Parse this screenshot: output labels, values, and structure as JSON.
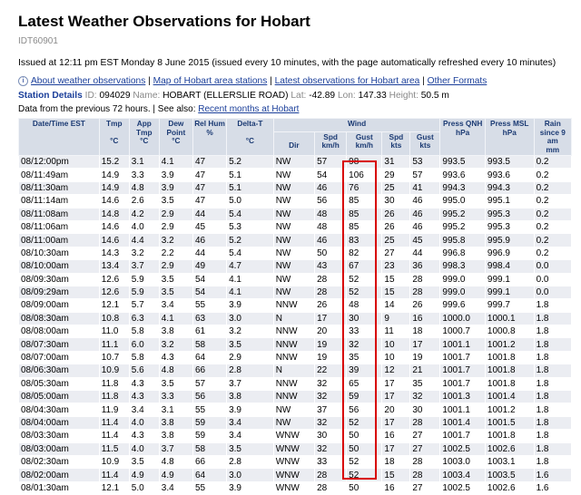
{
  "page": {
    "title": "Latest Weather Observations for Hobart",
    "product_id": "IDT60901",
    "issued": "Issued at 12:11 pm EST Monday 8 June 2015 (issued every 10 minutes, with the page automatically refreshed every 10 minutes)"
  },
  "links": {
    "about": "About weather observations",
    "map": "Map of Hobart area stations",
    "latest": "Latest observations for Hobart area",
    "formats": "Other Formats",
    "sep": " | "
  },
  "station": {
    "label": "Station Details",
    "id_label": "ID:",
    "id": "094029",
    "name_label": "Name:",
    "name": "HOBART (ELLERSLIE ROAD)",
    "lat_label": "Lat:",
    "lat": "-42.89",
    "lon_label": "Lon:",
    "lon": "147.33",
    "height_label": "Height:",
    "height": "50.5 m"
  },
  "prev": {
    "text": "Data from the previous 72 hours. | See also: ",
    "link": "Recent months at Hobart"
  },
  "table": {
    "headers": {
      "datetime": "Date/Time EST",
      "tmp": "Tmp",
      "tmp_unit": "°C",
      "app": "App Tmp",
      "app_unit": "°C",
      "dew": "Dew Point",
      "dew_unit": "°C",
      "rel": "Rel Hum",
      "rel_unit": "%",
      "delta": "Delta-T",
      "delta_unit": "°C",
      "wind": "Wind",
      "dir": "Dir",
      "spdkmh": "Spd",
      "spdkmh_unit": "km/h",
      "gustkmh": "Gust",
      "gustkmh_unit": "km/h",
      "spdkts": "Spd",
      "spdkts_unit": "kts",
      "gustkts": "Gust",
      "gustkts_unit": "kts",
      "qnh": "Press QNH",
      "qnh_unit": "hPa",
      "msl": "Press MSL",
      "msl_unit": "hPa",
      "rain": "Rain since 9 am",
      "rain_unit": "mm"
    },
    "rows": [
      [
        "08/12:00pm",
        "15.2",
        "3.1",
        "4.1",
        "47",
        "5.2",
        "NW",
        "57",
        "98",
        "31",
        "53",
        "993.5",
        "993.5",
        "0.2"
      ],
      [
        "08/11:49am",
        "14.9",
        "3.3",
        "3.9",
        "47",
        "5.1",
        "NW",
        "54",
        "106",
        "29",
        "57",
        "993.6",
        "993.6",
        "0.2"
      ],
      [
        "08/11:30am",
        "14.9",
        "4.8",
        "3.9",
        "47",
        "5.1",
        "NW",
        "46",
        "76",
        "25",
        "41",
        "994.3",
        "994.3",
        "0.2"
      ],
      [
        "08/11:14am",
        "14.6",
        "2.6",
        "3.5",
        "47",
        "5.0",
        "NW",
        "56",
        "85",
        "30",
        "46",
        "995.0",
        "995.1",
        "0.2"
      ],
      [
        "08/11:08am",
        "14.8",
        "4.2",
        "2.9",
        "44",
        "5.4",
        "NW",
        "48",
        "85",
        "26",
        "46",
        "995.2",
        "995.3",
        "0.2"
      ],
      [
        "08/11:06am",
        "14.6",
        "4.0",
        "2.9",
        "45",
        "5.3",
        "NW",
        "48",
        "85",
        "26",
        "46",
        "995.2",
        "995.3",
        "0.2"
      ],
      [
        "08/11:00am",
        "14.6",
        "4.4",
        "3.2",
        "46",
        "5.2",
        "NW",
        "46",
        "83",
        "25",
        "45",
        "995.8",
        "995.9",
        "0.2"
      ],
      [
        "08/10:30am",
        "14.3",
        "3.2",
        "2.2",
        "44",
        "5.4",
        "NW",
        "50",
        "82",
        "27",
        "44",
        "996.8",
        "996.9",
        "0.2"
      ],
      [
        "08/10:00am",
        "13.4",
        "3.7",
        "2.9",
        "49",
        "4.7",
        "NW",
        "43",
        "67",
        "23",
        "36",
        "998.3",
        "998.4",
        "0.0"
      ],
      [
        "08/09:30am",
        "12.6",
        "5.9",
        "3.5",
        "54",
        "4.1",
        "NW",
        "28",
        "52",
        "15",
        "28",
        "999.0",
        "999.1",
        "0.0"
      ],
      [
        "08/09:29am",
        "12.6",
        "5.9",
        "3.5",
        "54",
        "4.1",
        "NW",
        "28",
        "52",
        "15",
        "28",
        "999.0",
        "999.1",
        "0.0"
      ],
      [
        "08/09:00am",
        "12.1",
        "5.7",
        "3.4",
        "55",
        "3.9",
        "NNW",
        "26",
        "48",
        "14",
        "26",
        "999.6",
        "999.7",
        "1.8"
      ],
      [
        "08/08:30am",
        "10.8",
        "6.3",
        "4.1",
        "63",
        "3.0",
        "N",
        "17",
        "30",
        "9",
        "16",
        "1000.0",
        "1000.1",
        "1.8"
      ],
      [
        "08/08:00am",
        "11.0",
        "5.8",
        "3.8",
        "61",
        "3.2",
        "NNW",
        "20",
        "33",
        "11",
        "18",
        "1000.7",
        "1000.8",
        "1.8"
      ],
      [
        "08/07:30am",
        "11.1",
        "6.0",
        "3.2",
        "58",
        "3.5",
        "NNW",
        "19",
        "32",
        "10",
        "17",
        "1001.1",
        "1001.2",
        "1.8"
      ],
      [
        "08/07:00am",
        "10.7",
        "5.8",
        "4.3",
        "64",
        "2.9",
        "NNW",
        "19",
        "35",
        "10",
        "19",
        "1001.7",
        "1001.8",
        "1.8"
      ],
      [
        "08/06:30am",
        "10.9",
        "5.6",
        "4.8",
        "66",
        "2.8",
        "N",
        "22",
        "39",
        "12",
        "21",
        "1001.7",
        "1001.8",
        "1.8"
      ],
      [
        "08/05:30am",
        "11.8",
        "4.3",
        "3.5",
        "57",
        "3.7",
        "NNW",
        "32",
        "65",
        "17",
        "35",
        "1001.7",
        "1001.8",
        "1.8"
      ],
      [
        "08/05:00am",
        "11.8",
        "4.3",
        "3.3",
        "56",
        "3.8",
        "NNW",
        "32",
        "59",
        "17",
        "32",
        "1001.3",
        "1001.4",
        "1.8"
      ],
      [
        "08/04:30am",
        "11.9",
        "3.4",
        "3.1",
        "55",
        "3.9",
        "NW",
        "37",
        "56",
        "20",
        "30",
        "1001.1",
        "1001.2",
        "1.8"
      ],
      [
        "08/04:00am",
        "11.4",
        "4.0",
        "3.8",
        "59",
        "3.4",
        "NW",
        "32",
        "52",
        "17",
        "28",
        "1001.4",
        "1001.5",
        "1.8"
      ],
      [
        "08/03:30am",
        "11.4",
        "4.3",
        "3.8",
        "59",
        "3.4",
        "WNW",
        "30",
        "50",
        "16",
        "27",
        "1001.7",
        "1001.8",
        "1.8"
      ],
      [
        "08/03:00am",
        "11.5",
        "4.0",
        "3.7",
        "58",
        "3.5",
        "WNW",
        "32",
        "50",
        "17",
        "27",
        "1002.5",
        "1002.6",
        "1.8"
      ],
      [
        "08/02:30am",
        "10.9",
        "3.5",
        "4.8",
        "66",
        "2.8",
        "WNW",
        "33",
        "52",
        "18",
        "28",
        "1003.0",
        "1003.1",
        "1.8"
      ],
      [
        "08/02:00am",
        "11.4",
        "4.9",
        "4.9",
        "64",
        "3.0",
        "WNW",
        "28",
        "52",
        "15",
        "28",
        "1003.4",
        "1003.5",
        "1.6"
      ],
      [
        "08/01:30am",
        "12.1",
        "5.0",
        "3.4",
        "55",
        "3.9",
        "WNW",
        "28",
        "50",
        "16",
        "27",
        "1002.5",
        "1002.6",
        "1.6"
      ]
    ]
  }
}
